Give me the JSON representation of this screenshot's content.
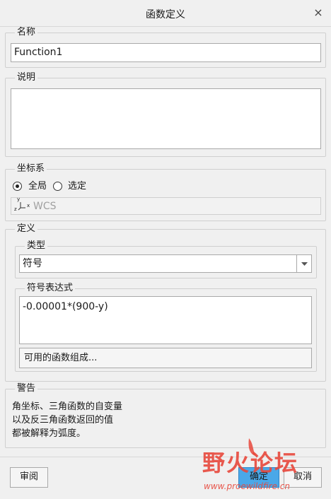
{
  "dialog": {
    "title": "函数定义",
    "close_glyph": "×"
  },
  "name_group": {
    "label": "名称",
    "value": "Function1"
  },
  "description_group": {
    "label": "说明",
    "value": ""
  },
  "coord_group": {
    "label": "坐标系",
    "option_global": "全局",
    "option_selected": "选定",
    "selected": "全局",
    "csys_value": "WCS",
    "csys_axis_y": "y",
    "csys_axis_x": "x",
    "csys_axis_z": "z"
  },
  "definition_group": {
    "label": "定义",
    "type_group": {
      "label": "类型",
      "value": "符号"
    },
    "expr_group": {
      "label": "符号表达式",
      "value": "-0.00001*(900-y)"
    },
    "functions_button": "可用的函数组成..."
  },
  "warning_group": {
    "label": "警告",
    "lines": [
      "角坐标、三角函数的自变量",
      "以及反三角函数返回的值",
      "都被解释为弧度。"
    ]
  },
  "footer": {
    "review_button": "审阅",
    "ok_button": "确定",
    "cancel_button": "取消"
  },
  "watermark": {
    "text": "野火论坛",
    "url": "www.proewildfire.cn"
  },
  "colors": {
    "watermark_red": "#e8483c",
    "ok_blue": "#4aa8e8",
    "cancel_orange": "#e89a6a"
  }
}
